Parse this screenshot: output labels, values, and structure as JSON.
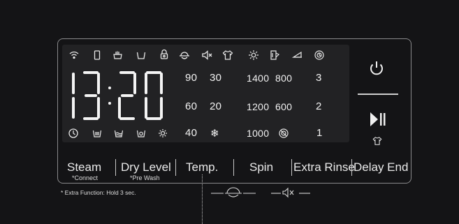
{
  "time_display": {
    "hours": "13",
    "minutes": "20"
  },
  "top_icons": [
    "wifi-icon",
    "phone-icon",
    "hand-wash-icon",
    "tub-icon",
    "child-lock-icon",
    "steam-basin-icon",
    "mute-icon",
    "shirt-icon",
    "sun-icon",
    "clean-door-icon",
    "drum-clean-icon",
    "speed-icon"
  ],
  "bottom_icons": [
    "clock-icon",
    "prewash-tub-icon",
    "basin-wave-icon",
    "drum-dot-icon",
    "sun-small-icon"
  ],
  "temperatures": {
    "r1": [
      "90",
      "30"
    ],
    "r2": [
      "60",
      "20"
    ],
    "r3": [
      "40"
    ]
  },
  "spin_speeds": {
    "r1": [
      "1400",
      "800"
    ],
    "r2": [
      "1200",
      "600"
    ],
    "r3": [
      "1000"
    ]
  },
  "extra_rinse_counts": [
    "3",
    "2",
    "1"
  ],
  "buttons": {
    "steam": "Steam",
    "steam_sub": "*Connect",
    "dry_level": "Dry Level",
    "dry_level_sub": "*Pre Wash",
    "temp": "Temp.",
    "spin": "Spin",
    "extra_rinse": "Extra Rinse",
    "delay_end": "Delay End"
  },
  "footnote": "* Extra Function: Hold 3 sec."
}
